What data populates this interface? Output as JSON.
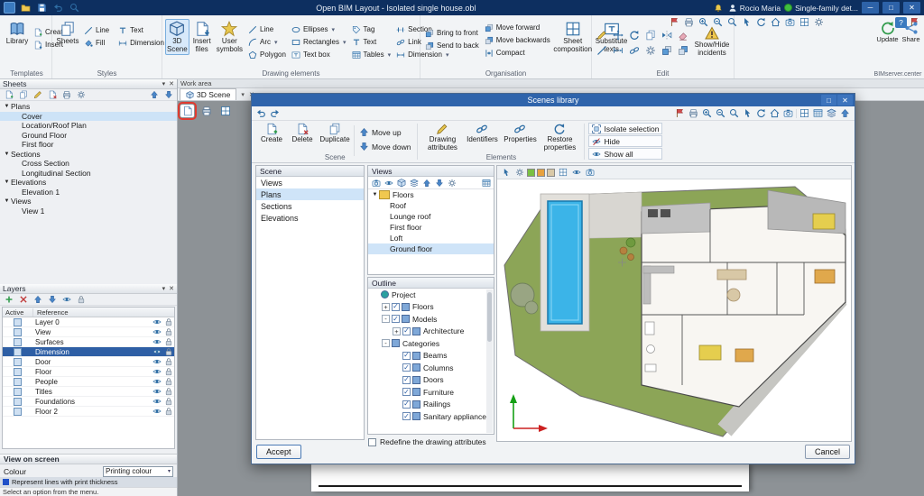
{
  "colors": {
    "titlebar": "#0d2f60",
    "accent_blue": "#2f64ab",
    "selection_light": "#cfe4f8",
    "selection_dark": "#2e5fa5",
    "lawn_green": "#8ca557",
    "pool_blue": "#3bb4e8",
    "highlight_red": "#e03b30"
  },
  "icons": {
    "caret_down": "▾",
    "expander": "▼",
    "check": "✓",
    "close": "✕",
    "minimize": "─",
    "maximize": "□",
    "help": "?"
  },
  "titlebar": {
    "title": "Open BIM Layout - Isolated single house.obl",
    "user": "Rocio Maria",
    "project": "Single-family det..."
  },
  "ribbon": {
    "templates": {
      "label": "Templates",
      "library": "Library",
      "create": "Create",
      "insert": "Insert"
    },
    "styles": {
      "label": "Styles",
      "sheets": "Sheets",
      "line": "Line",
      "text": "Text",
      "fill": "Fill",
      "dimension": "Dimension"
    },
    "drawing": {
      "label": "Drawing elements",
      "scene3d": "3D Scene",
      "insert_files": "Insert files",
      "user_symbols": "User symbols",
      "line": "Line",
      "arc": "Arc",
      "polygon": "Polygon",
      "ellipses": "Ellipses",
      "rectangles": "Rectangles",
      "text_box": "Text box",
      "tag": "Tag",
      "text": "Text",
      "tables": "Tables",
      "section": "Section",
      "link": "Link",
      "dimension": "Dimension"
    },
    "organisation": {
      "label": "Organisation",
      "bring_to_front": "Bring to front",
      "send_to_back": "Send to back",
      "move_forward": "Move forward",
      "move_backwards": "Move backwards",
      "compact": "Compact",
      "sheet_composition": "Sheet composition",
      "substitute_texts": "Substitute texts"
    },
    "edit": {
      "label": "Edit",
      "show_hide_incidents": "Show/Hide incidents"
    },
    "bimserver": {
      "label": "BIMserver.center",
      "update": "Update",
      "share": "Share"
    }
  },
  "sheets_panel": {
    "title": "Sheets",
    "tree": [
      {
        "label": "Plans",
        "cls": "group",
        "level": 0,
        "exp": "▼"
      },
      {
        "label": "Cover",
        "cls": "sel",
        "level": 1,
        "exp": ""
      },
      {
        "label": "Location/Roof Plan",
        "level": 1,
        "exp": ""
      },
      {
        "label": "Ground Floor",
        "level": 1,
        "exp": ""
      },
      {
        "label": "First floor",
        "level": 1,
        "exp": ""
      },
      {
        "label": "Sections",
        "cls": "group",
        "level": 0,
        "exp": "▼"
      },
      {
        "label": "Cross Section",
        "level": 1,
        "exp": ""
      },
      {
        "label": "Longitudinal Section",
        "level": 1,
        "exp": ""
      },
      {
        "label": "Elevations",
        "cls": "group",
        "level": 0,
        "exp": "▼"
      },
      {
        "label": "Elevation 1",
        "level": 1,
        "exp": ""
      },
      {
        "label": "Views",
        "cls": "group",
        "level": 0,
        "exp": "▼"
      },
      {
        "label": "View 1",
        "level": 1,
        "exp": ""
      }
    ]
  },
  "layers_panel": {
    "title": "Layers",
    "columns": {
      "active": "Active",
      "reference": "Reference"
    },
    "rows": [
      {
        "name": "Layer 0"
      },
      {
        "name": "View"
      },
      {
        "name": "Surfaces"
      },
      {
        "name": "Dimension",
        "cls": "sel"
      },
      {
        "name": "Door"
      },
      {
        "name": "Floor"
      },
      {
        "name": "People"
      },
      {
        "name": "Titles"
      },
      {
        "name": "Foundations"
      },
      {
        "name": "Floor 2"
      }
    ]
  },
  "view_on_screen": {
    "title": "View on screen",
    "colour_label": "Colour",
    "colour_value": "Printing colour",
    "legend": "Represent lines with print thickness",
    "status": "Select an option from the menu."
  },
  "workarea": {
    "label": "Work area",
    "tab": "3D Scene"
  },
  "dialog": {
    "title": "Scenes library",
    "commands": {
      "create": "Create",
      "delete": "Delete",
      "duplicate": "Duplicate",
      "move_up": "Move up",
      "move_down": "Move down",
      "scene_group": "Scene",
      "drawing_attributes": "Drawing attributes",
      "identifiers": "Identifiers",
      "properties": "Properties",
      "restore_properties": "Restore properties",
      "elements_group": "Elements",
      "isolate_selection": "Isolate selection",
      "hide": "Hide",
      "show_all": "Show all"
    },
    "scene_list": {
      "title": "Scene",
      "items": [
        {
          "label": "Views"
        },
        {
          "label": "Plans",
          "cls": "sel"
        },
        {
          "label": "Sections"
        },
        {
          "label": "Elevations"
        }
      ]
    },
    "views_panel": {
      "title": "Views",
      "tree": [
        {
          "label": "Floors",
          "cls": "group",
          "level": 0,
          "exp": "▼"
        },
        {
          "label": "Roof",
          "level": 1,
          "exp": ""
        },
        {
          "label": "Lounge roof",
          "level": 1,
          "exp": ""
        },
        {
          "label": "First floor",
          "level": 1,
          "exp": ""
        },
        {
          "label": "Loft",
          "level": 1,
          "exp": ""
        },
        {
          "label": "Ground floor",
          "cls": "sel",
          "level": 1,
          "exp": ""
        }
      ]
    },
    "outline_panel": {
      "title": "Outline",
      "tree": [
        {
          "label": "Project",
          "cls": "project",
          "level": 0,
          "exp": ""
        },
        {
          "label": "Floors",
          "level": 1,
          "exp": "+"
        },
        {
          "label": "Models",
          "level": 1,
          "exp": "-"
        },
        {
          "label": "Architecture",
          "level": 2,
          "exp": "+"
        },
        {
          "label": "Categories",
          "cls": "noch",
          "level": 1,
          "exp": "-"
        },
        {
          "label": "Beams",
          "level": 2,
          "exp": ""
        },
        {
          "label": "Columns",
          "level": 2,
          "exp": ""
        },
        {
          "label": "Doors",
          "level": 2,
          "exp": ""
        },
        {
          "label": "Furniture",
          "level": 2,
          "exp": ""
        },
        {
          "label": "Railings",
          "level": 2,
          "exp": ""
        },
        {
          "label": "Sanitary appliances",
          "level": 2,
          "exp": ""
        }
      ]
    },
    "redefine_label": "Redefine the drawing attributes",
    "accept": "Accept",
    "cancel": "Cancel"
  }
}
